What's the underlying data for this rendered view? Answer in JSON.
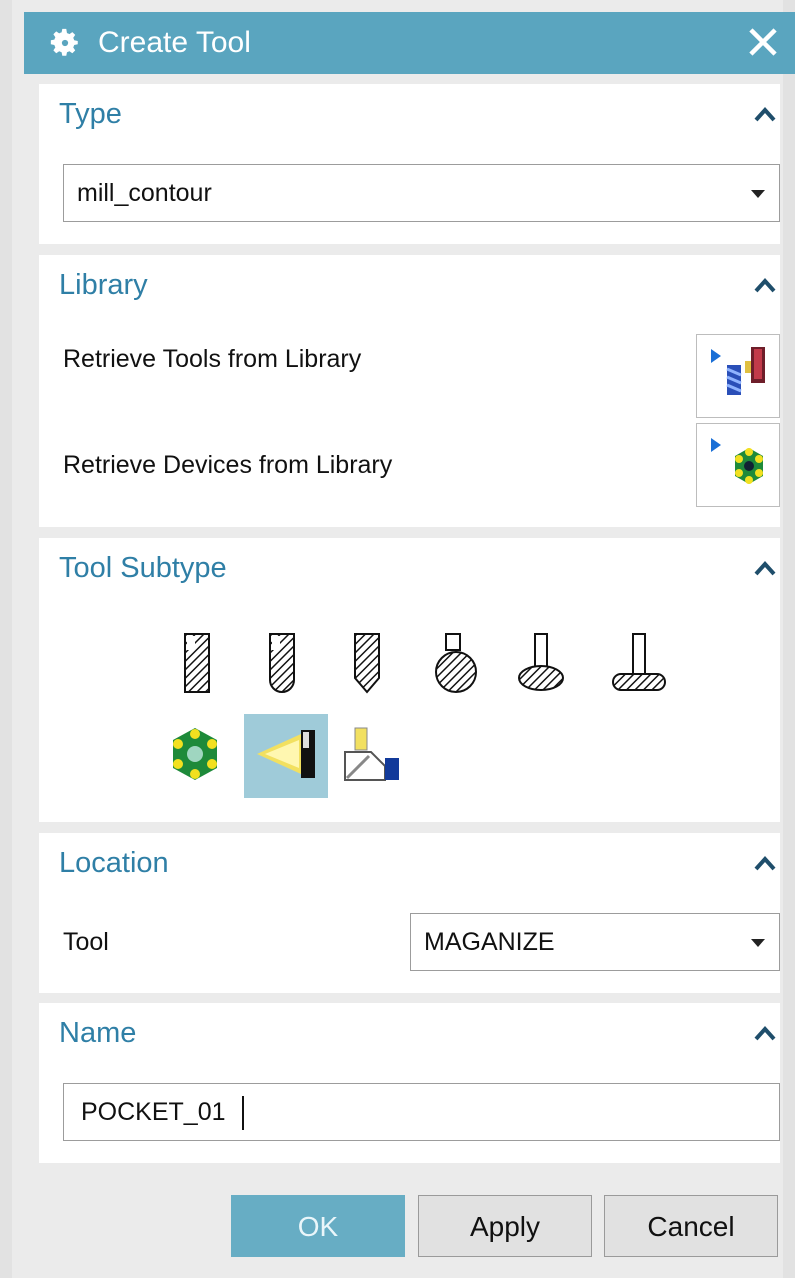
{
  "dialog": {
    "title": "Create Tool",
    "icons": {
      "title": "gear-icon",
      "close": "close-icon"
    }
  },
  "sections": {
    "type": {
      "title": "Type",
      "select_value": "mill_contour"
    },
    "library": {
      "title": "Library",
      "retrieve_tools_label": "Retrieve Tools from Library",
      "retrieve_devices_label": "Retrieve Devices from Library",
      "icons": {
        "tools": "retrieve-tools-library-icon",
        "devices": "retrieve-devices-library-icon"
      }
    },
    "tool_subtype": {
      "title": "Tool Subtype",
      "items": [
        {
          "icon": "mill-endmill-icon",
          "selected": false
        },
        {
          "icon": "mill-ballmill-icon",
          "selected": false
        },
        {
          "icon": "mill-drill-icon",
          "selected": false
        },
        {
          "icon": "mill-barrel-icon",
          "selected": false
        },
        {
          "icon": "mill-t-cutter-icon",
          "selected": false
        },
        {
          "icon": "mill-disc-cutter-icon",
          "selected": false
        },
        {
          "icon": "carrier-head-icon",
          "selected": false
        },
        {
          "icon": "magazine-icon",
          "selected": true
        },
        {
          "icon": "pocket-icon",
          "selected": false
        }
      ]
    },
    "location": {
      "title": "Location",
      "tool_label": "Tool",
      "tool_value": "MAGANIZE"
    },
    "name": {
      "title": "Name",
      "value": "POCKET_01"
    }
  },
  "buttons": {
    "ok": "OK",
    "apply": "Apply",
    "cancel": "Cancel"
  },
  "colors": {
    "titlebar": "#5aa5bf",
    "section_title": "#2f7fa6",
    "selected_bg": "#9fcbd9",
    "ok_button": "#67adc4"
  }
}
